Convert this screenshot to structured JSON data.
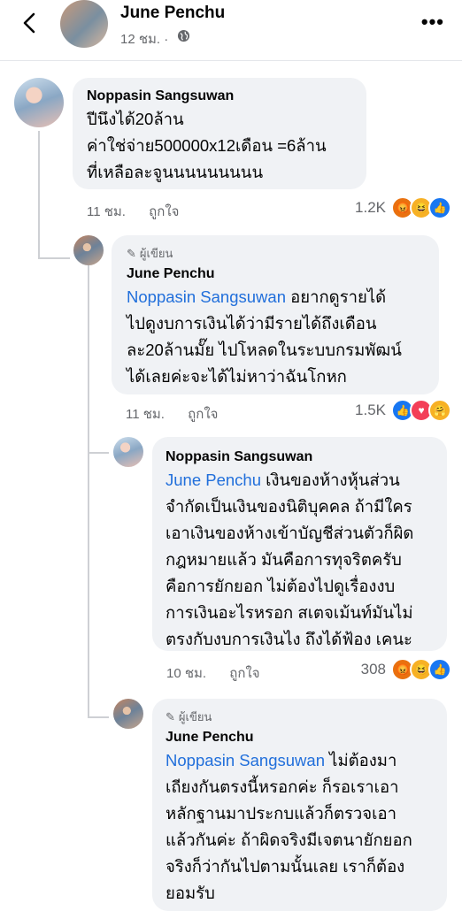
{
  "header": {
    "name": "June Penchu",
    "time": "12 ชม. ·",
    "more_label": "•••"
  },
  "comments": [
    {
      "author": "Noppasin Sangsuwan",
      "is_author": false,
      "lines": [
        "ปีนึงได้20ล้าน",
        "ค่าใช่จ่าย500000x12เดือน =6ล้าน",
        "ที่เหลือละจูนนนนนนนนน"
      ],
      "time": "11 ชม.",
      "like_label": "ถูกใจ",
      "count": "1.2K",
      "reactions": [
        "angry",
        "haha",
        "like"
      ]
    },
    {
      "author": "June Penchu",
      "is_author": true,
      "author_badge": "ผู้เขียน",
      "mention": "Noppasin Sangsuwan",
      "first": " อยากดูรายได้",
      "lines": [
        "ไปดูงบการเงินได้ว่ามีรายได้ถึงเดือน",
        "ละ20ล้านมั๊ย ไปโหลดในระบบกรมพัฒน์",
        "ได้เลยค่ะจะได้ไม่หาว่าฉันโกหก"
      ],
      "time": "11 ชม.",
      "like_label": "ถูกใจ",
      "count": "1.5K",
      "reactions": [
        "like",
        "love",
        "care"
      ]
    },
    {
      "author": "Noppasin Sangsuwan",
      "is_author": false,
      "mention": "June Penchu",
      "first": " เงินของห้างหุ้นส่วน",
      "lines": [
        "จำกัดเป็นเงินของนิติบุคคล ถ้ามีใคร",
        "เอาเงินของห้างเข้าบัญชีส่วนตัวก็ผิด",
        "กฎหมายแล้ว มันคือการทุจริตครับ",
        "คือการยักยอก ไม่ต้องไปดูเรื่องงบ",
        "การเงินอะไรหรอก สเตจเม้นท์มันไม่",
        "ตรงกับงบการเงินไง ถึงได้ฟ้อง เคนะ"
      ],
      "time": "10 ชม.",
      "like_label": "ถูกใจ",
      "count": "308",
      "reactions": [
        "angry",
        "haha",
        "like"
      ]
    },
    {
      "author": "June Penchu",
      "is_author": true,
      "author_badge": "ผู้เขียน",
      "mention": "Noppasin Sangsuwan",
      "first": " ไม่ต้องมา",
      "lines": [
        "เถียงกันตรงนี้หรอกค่ะ ก็รอเราเอา",
        "หลักฐานมาประกบแล้วก็ตรวจเอา",
        "แล้วกันค่ะ ถ้าผิดจริงมีเจตนายักยอก",
        "จริงก็ว่ากันไปตามนั้นเลย เราก็ต้อง",
        "ยอมรับ"
      ]
    }
  ]
}
